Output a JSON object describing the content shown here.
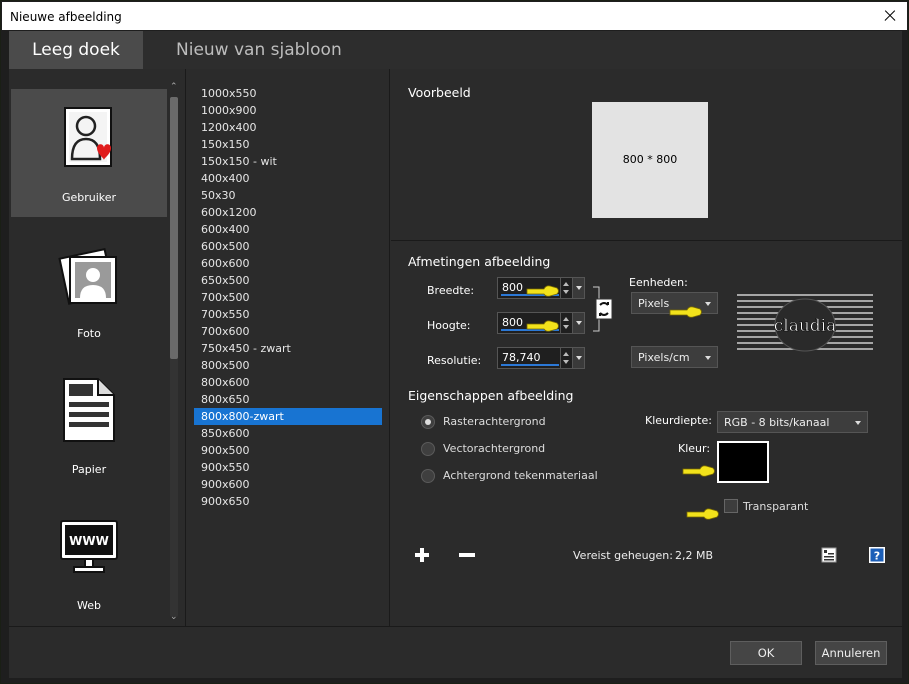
{
  "window": {
    "title": "Nieuwe afbeelding"
  },
  "tabs": [
    {
      "label": "Leeg doek",
      "active": true
    },
    {
      "label": "Nieuw van sjabloon",
      "active": false
    }
  ],
  "categories": [
    {
      "label": "Gebruiker",
      "icon": "user-heart-icon",
      "selected": true
    },
    {
      "label": "Foto",
      "icon": "photo-icon",
      "selected": false
    },
    {
      "label": "Papier",
      "icon": "paper-document-icon",
      "selected": false
    },
    {
      "label": "Web",
      "icon": "web-monitor-icon",
      "selected": false
    }
  ],
  "web_icon_text": "WWW",
  "sizes": [
    "1000x550",
    "1000x900",
    "1200x400",
    "150x150",
    "150x150 - wit",
    "400x400",
    "50x30",
    "600x1200",
    "600x400",
    "600x500",
    "600x600",
    "650x500",
    "700x500",
    "700x550",
    "700x600",
    "750x450 - zwart",
    "800x500",
    "800x600",
    "800x650",
    "800x800-zwart",
    "850x600",
    "900x500",
    "900x550",
    "900x600",
    "900x650"
  ],
  "selected_size": "800x800-zwart",
  "preview": {
    "title": "Voorbeeld",
    "text": "800 * 800"
  },
  "dimensions": {
    "title": "Afmetingen afbeelding",
    "width_label": "Breedte:",
    "width_value": "800",
    "height_label": "Hoogte:",
    "height_value": "800",
    "resolution_label": "Resolutie:",
    "resolution_value": "78,740",
    "units_label": "Eenheden:",
    "units_value": "Pixels",
    "res_units_value": "Pixels/cm",
    "logo_text": "claudia"
  },
  "properties": {
    "title": "Eigenschappen afbeelding",
    "radios": [
      {
        "label": "Rasterachtergrond",
        "checked": true
      },
      {
        "label": "Vectorachtergrond",
        "checked": false
      },
      {
        "label": "Achtergrond tekenmateriaal",
        "checked": false
      }
    ],
    "color_depth_label": "Kleurdiepte:",
    "color_depth_value": "RGB - 8 bits/kanaal",
    "color_label": "Kleur:",
    "color_value": "#000000",
    "transparent_label": "Transparant",
    "transparent_checked": false,
    "memory_label": "Vereist geheugen:",
    "memory_value": "2,2 MB"
  },
  "footer": {
    "ok_label": "OK",
    "cancel_label": "Annuleren"
  },
  "colors": {
    "selection_blue": "#1874d2",
    "hand_yellow": "#f2e21b"
  }
}
